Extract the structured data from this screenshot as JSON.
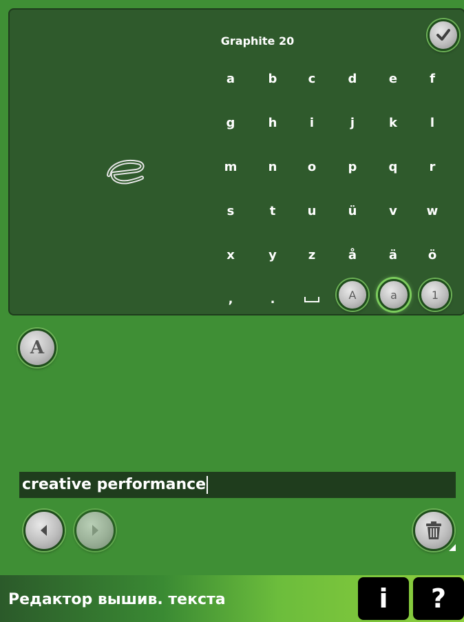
{
  "font_name": "Graphite 20",
  "keys": [
    [
      "a",
      "b",
      "c",
      "d",
      "e",
      "f"
    ],
    [
      "g",
      "h",
      "i",
      "j",
      "k",
      "l"
    ],
    [
      "m",
      "n",
      "o",
      "p",
      "q",
      "r"
    ],
    [
      "s",
      "t",
      "u",
      "ü",
      "v",
      "w"
    ],
    [
      "x",
      "y",
      "z",
      "å",
      "ä",
      "ö"
    ]
  ],
  "punctuation_keys": [
    ",",
    ".",
    "␣"
  ],
  "case_buttons": [
    {
      "label": "A",
      "selected": false
    },
    {
      "label": "a",
      "selected": true
    },
    {
      "label": "1",
      "selected": false
    }
  ],
  "preview_letter": "e",
  "font_button_label": "A",
  "text_value": "creative performance",
  "window_title": "Редактор вышив. текста",
  "info_button_label": "i",
  "help_button_label": "?",
  "icons": {
    "confirm": "checkmark-icon",
    "prev": "arrow-left-icon",
    "next": "arrow-right-icon",
    "delete": "trash-icon"
  },
  "colors": {
    "background": "#3f8f35",
    "panel": "#2f5a2c",
    "text_field": "#1f3d1d",
    "button_ring": "#6db257"
  }
}
